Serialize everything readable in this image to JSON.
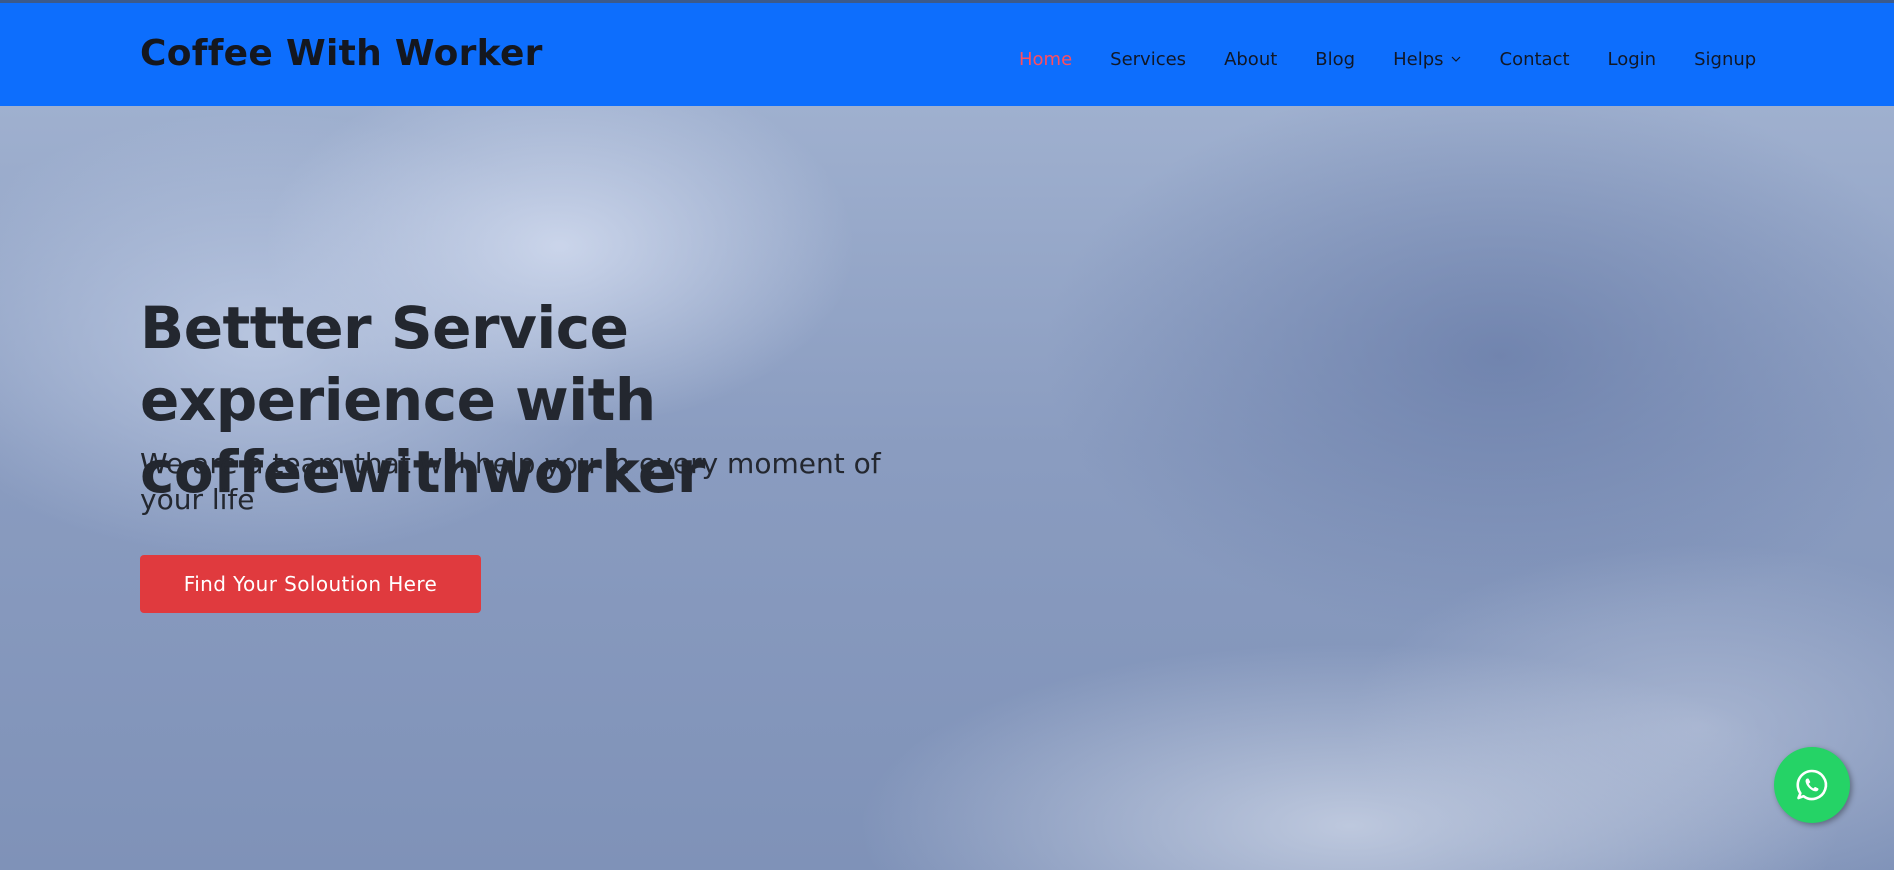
{
  "header": {
    "logo_text": "Coffee With Worker",
    "nav": [
      {
        "label": "Home",
        "active": true
      },
      {
        "label": "Services"
      },
      {
        "label": "About"
      },
      {
        "label": "Blog"
      },
      {
        "label": "Helps",
        "has_dropdown": true
      },
      {
        "label": "Contact"
      },
      {
        "label": "Login"
      },
      {
        "label": "Signup"
      }
    ]
  },
  "hero": {
    "title": "Bettter Service experience with coffeewithworker",
    "subtitle": "We are a team that will help you in every moment of your life",
    "cta_label": "Find Your Soloution Here"
  },
  "floating": {
    "whatsapp_icon": "whatsapp-icon"
  },
  "colors": {
    "header_bg": "#0d6efd",
    "nav_active": "#ff4d5e",
    "cta_bg": "#e03a3e",
    "whatsapp_bg": "#25d366"
  }
}
